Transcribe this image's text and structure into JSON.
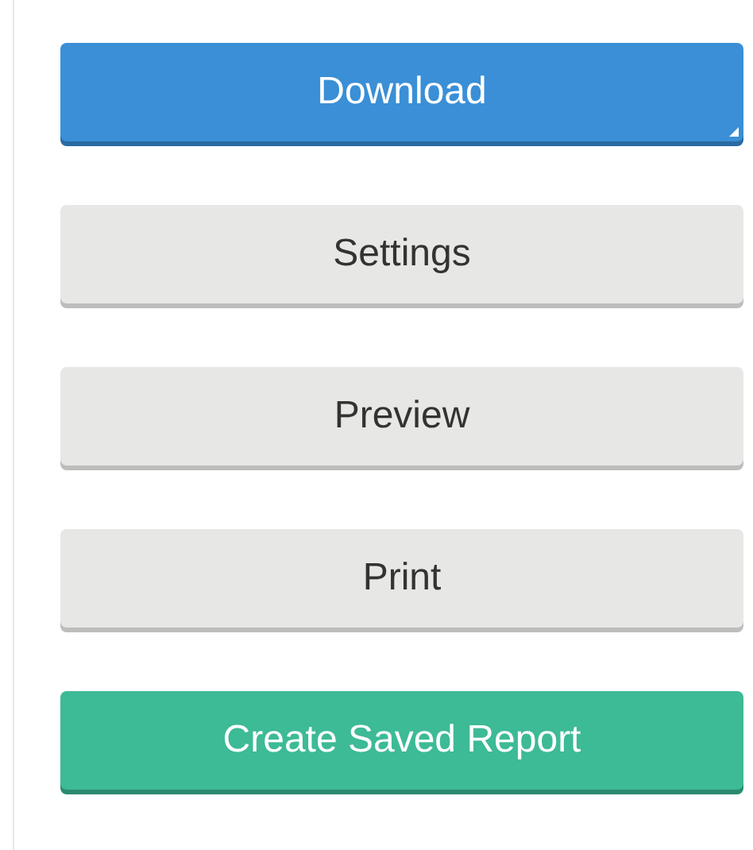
{
  "buttons": [
    {
      "label": "Download",
      "kind": "primary",
      "has_menu": true
    },
    {
      "label": "Settings",
      "kind": "default",
      "has_menu": false
    },
    {
      "label": "Preview",
      "kind": "default",
      "has_menu": false
    },
    {
      "label": "Print",
      "kind": "default",
      "has_menu": false
    },
    {
      "label": "Create Saved Report",
      "kind": "success",
      "has_menu": false
    }
  ]
}
